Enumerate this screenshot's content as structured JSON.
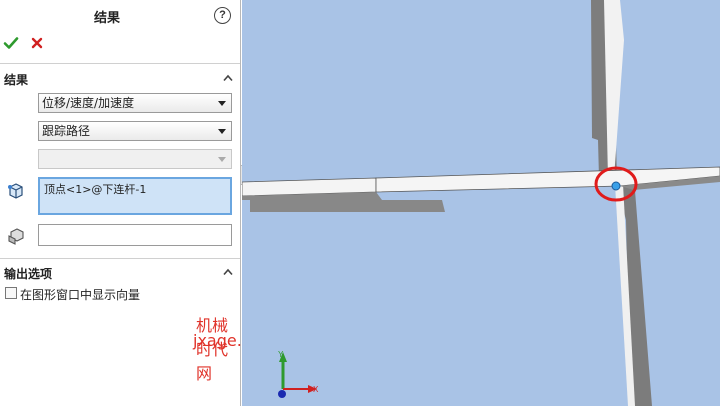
{
  "panel": {
    "title": "结果",
    "help_icon": "?",
    "ok_icon": "checkmark-icon",
    "cancel_icon": "close-icon"
  },
  "results_group": {
    "header": "结果",
    "result_type": "位移/速度/加速度",
    "result_subtype": "跟踪路径",
    "component_select": "",
    "selection_entity": "顶点<1>@下连杆-1",
    "reference_entity": ""
  },
  "output_group": {
    "header": "输出选项",
    "show_vector_label": "在图形窗口中显示向量",
    "show_vector_checked": false
  },
  "watermark": {
    "line1": "机械时代网",
    "line2": "jxage.com"
  },
  "triad": {
    "y_label": "Y",
    "x_label": "X"
  },
  "colors": {
    "viewport_bg": "#a9c3e6",
    "accent_ok": "#2e9a2e",
    "accent_cancel": "#d02020",
    "highlight_circle": "#e01b1b",
    "selection_point": "#3aa0e8"
  }
}
